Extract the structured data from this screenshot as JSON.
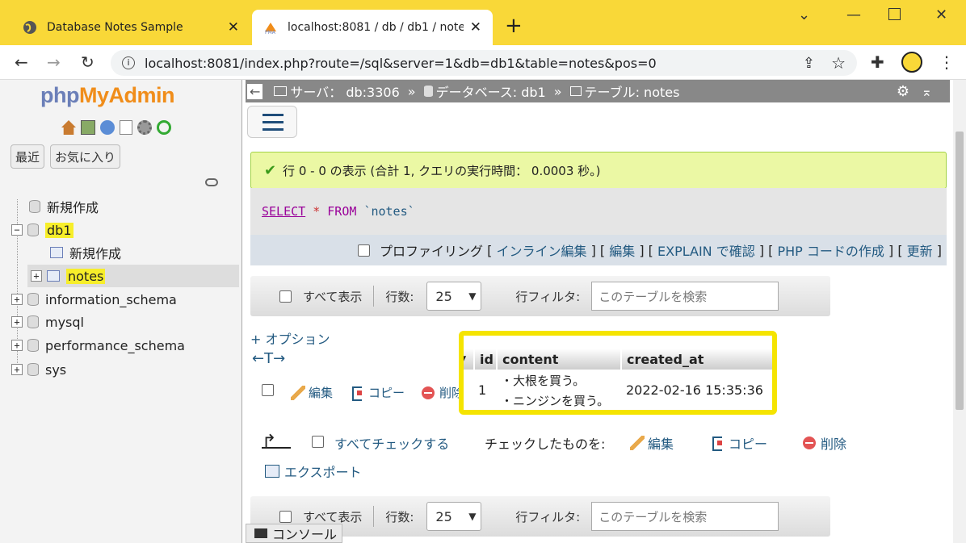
{
  "browser": {
    "tabs": [
      {
        "title": "Database Notes Sample",
        "close": "✕"
      },
      {
        "title": "localhost:8081 / db / db1 / notes",
        "close": "✕"
      }
    ],
    "new_tab": "+",
    "url": "localhost:8081/index.php?route=/sql&server=1&db=db1&table=notes&pos=0"
  },
  "sidebar": {
    "logo_php": "php",
    "logo_myadmin": "MyAdmin",
    "recent_label": "最近",
    "favorites_label": "お気に入り",
    "tree": [
      {
        "label": "新規作成"
      },
      {
        "label": "db1"
      },
      {
        "label": "新規作成"
      },
      {
        "label": "notes"
      },
      {
        "label": "information_schema"
      },
      {
        "label": "mysql"
      },
      {
        "label": "performance_schema"
      },
      {
        "label": "sys"
      }
    ]
  },
  "breadcrumb": {
    "server": "サーバ： db:3306",
    "sep": "»",
    "database": "データベース: db1",
    "table": "テーブル: notes"
  },
  "result": {
    "message": "行 0 - 0 の表示 (合計 1, クエリの実行時間： 0.0003 秒。)",
    "query_select": "SELECT",
    "query_star": "*",
    "query_from": "FROM",
    "query_table": "`notes`",
    "profiling": "プロファイリング",
    "links": [
      "インライン編集",
      "編集",
      "EXPLAIN で確認",
      "PHP コードの作成",
      "更新"
    ]
  },
  "nav": {
    "show_all": "すべて表示",
    "rows_label": "行数:",
    "rows_value": "25",
    "filter_label": "行フィルタ:",
    "filter_placeholder": "このテーブルを検索"
  },
  "table": {
    "options": "+ オプション",
    "columns": [
      "id",
      "content",
      "created_at"
    ],
    "rows": [
      {
        "id": "1",
        "content": [
          "・大根を買う。",
          "・ニンジンを買う。"
        ],
        "created_at": "2022-02-16 15:35:36"
      }
    ],
    "actions": {
      "edit": "編集",
      "copy": "コピー",
      "delete": "削除"
    }
  },
  "bulk": {
    "check_all": "すべてチェックする",
    "with_selected": "チェックしたものを:",
    "edit": "編集",
    "copy": "コピー",
    "delete": "削除",
    "export": "エクスポート"
  },
  "console": "コンソール",
  "colors": {
    "titlebar": "#f9d838",
    "success_bg": "#ebf8a4",
    "link": "#235a81",
    "highlight": "#f7ee2a"
  }
}
